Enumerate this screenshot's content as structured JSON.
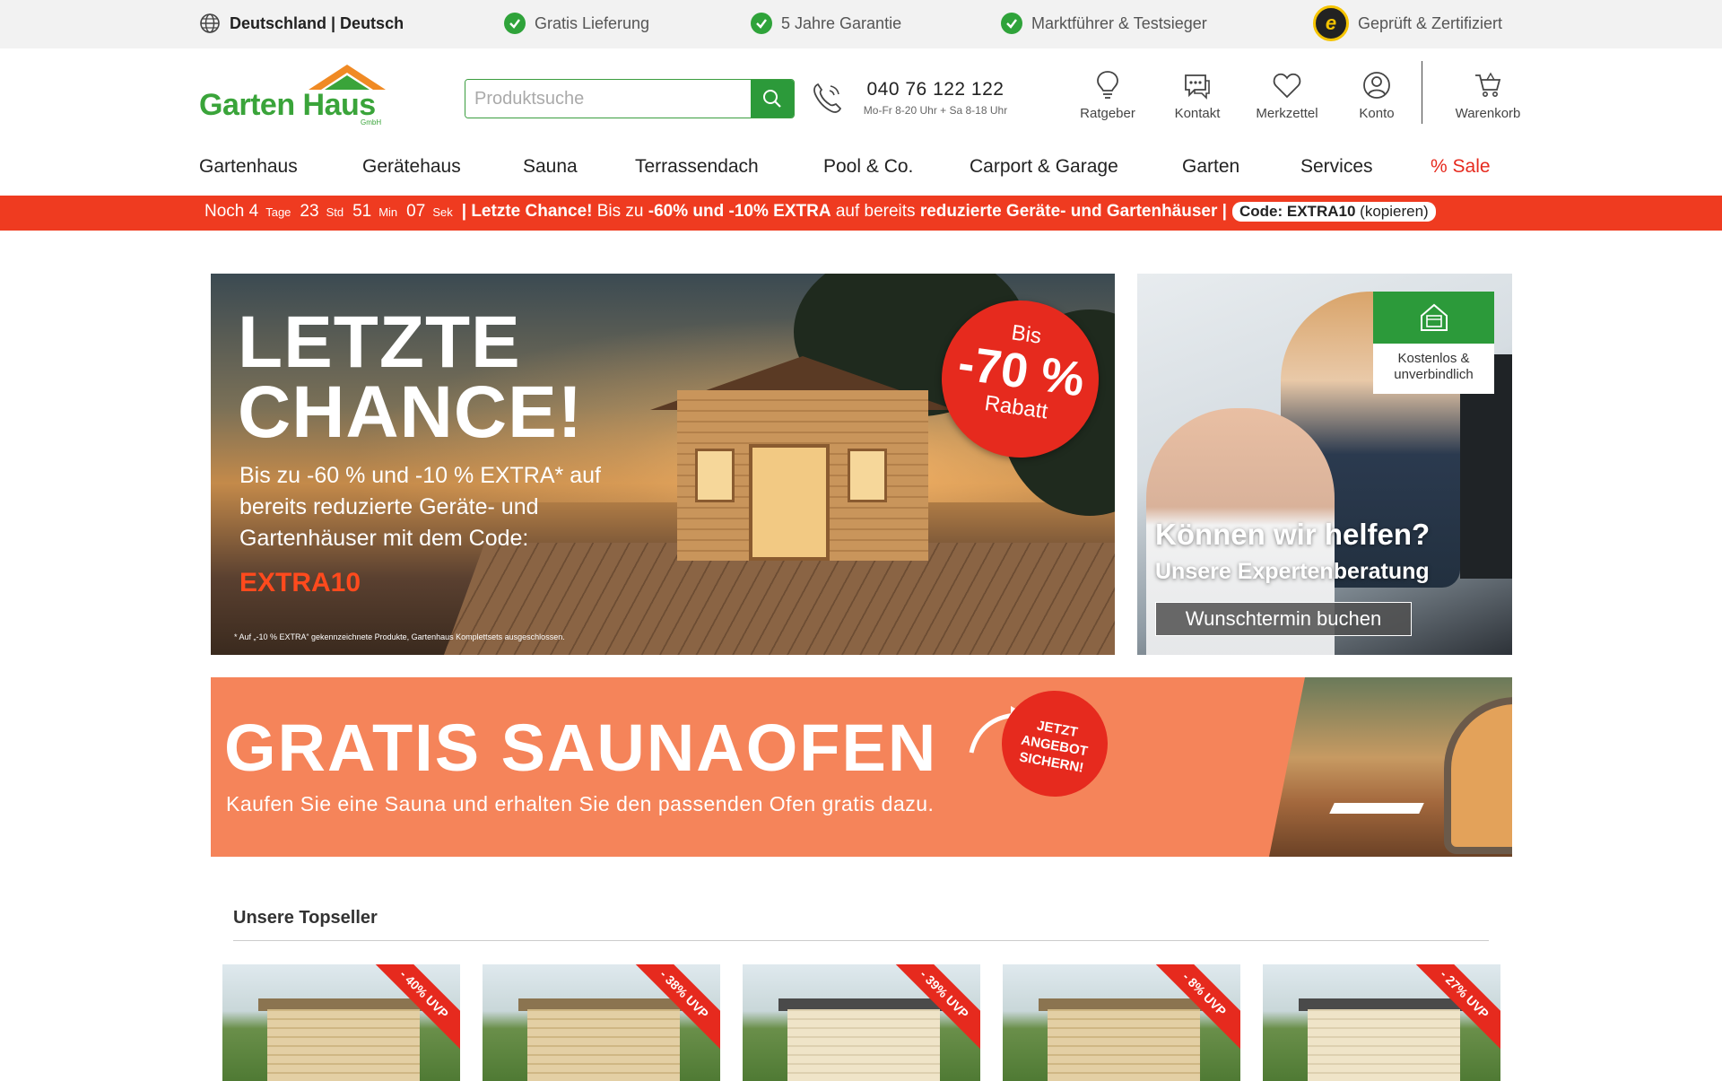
{
  "topbar": {
    "language": "Deutschland | Deutsch",
    "usps": [
      "Gratis Lieferung",
      "5 Jahre Garantie",
      "Marktführer & Testsieger"
    ],
    "certified": "Geprüft & Zertifiziert",
    "trusted_letter": "e"
  },
  "header": {
    "logo": "Garten Haus",
    "logo_sub": "GmbH",
    "search_placeholder": "Produktsuche",
    "phone": "040 76 122 122",
    "hours": "Mo-Fr 8-20 Uhr + Sa 8-18 Uhr",
    "icons": {
      "ratgeber": "Ratgeber",
      "kontakt": "Kontakt",
      "merkzettel": "Merkzettel",
      "konto": "Konto",
      "warenkorb": "Warenkorb"
    }
  },
  "nav": {
    "items": [
      "Gartenhaus",
      "Gerätehaus",
      "Sauna",
      "Terrassendach",
      "Pool & Co.",
      "Carport & Garage",
      "Garten",
      "Services"
    ],
    "sale": "% Sale"
  },
  "promo": {
    "prefix": "Noch",
    "days": "4",
    "days_label": "Tage",
    "hours": "23",
    "hours_label": "Std",
    "minutes": "51",
    "minutes_label": "Min",
    "seconds": "07",
    "seconds_label": "Sek",
    "sep": "|",
    "headline": "Letzte Chance!",
    "text1": "Bis zu",
    "discount": "-60% und -10% EXTRA",
    "text2": "auf bereits",
    "target": "reduzierte Geräte- und Gartenhäuser",
    "code_label": "Code: EXTRA10",
    "code_action": "(kopieren)"
  },
  "hero": {
    "title_line1": "LETZTE",
    "title_line2": "CHANCE!",
    "text": "Bis zu -60 % und -10 % EXTRA* auf bereits reduzierte Geräte- und Gartenhäuser mit dem Code:",
    "code": "EXTRA10",
    "fine_print": "* Auf „-10 % EXTRA“ gekennzeichnete Produkte, Gartenhaus Komplettsets ausgeschlossen.",
    "badge_top": "Bis",
    "badge_main": "-70 %",
    "badge_bottom": "Rabatt"
  },
  "help": {
    "card_text": "Kostenlos & unverbindlich",
    "title": "Können wir helfen?",
    "subtitle": "Unsere Expertenberatung",
    "button": "Wunschtermin buchen"
  },
  "sauna": {
    "title": "GRATIS SAUNAOFEN",
    "subtitle": "Kaufen Sie eine Sauna und erhalten Sie den passenden Ofen gratis dazu.",
    "badge_l1": "JETZT",
    "badge_l2": "ANGEBOT",
    "badge_l3": "SICHERN!"
  },
  "topseller": {
    "title": "Unsere Topseller",
    "badges": [
      "- 40% UVP",
      "- 38% UVP",
      "- 39% UVP",
      "- 8% UVP",
      "- 27% UVP"
    ]
  },
  "colors": {
    "green": "#2c9a3a",
    "red": "#e62a1e",
    "orange_banner": "#f5845a",
    "promo_bar": "#ef3b20"
  }
}
